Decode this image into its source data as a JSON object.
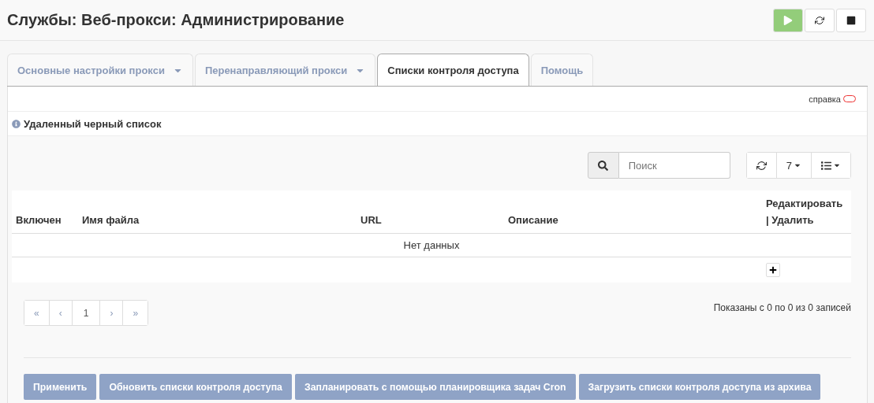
{
  "page_title": "Службы: Веб-прокси: Администрирование",
  "tabs": [
    {
      "label": "Основные настройки прокси",
      "selected": false,
      "has_menu": true
    },
    {
      "label": "Перенаправляющий прокси",
      "selected": false,
      "has_menu": true
    },
    {
      "label": "Списки контроля доступа",
      "selected": true,
      "has_menu": false
    },
    {
      "label": "Помощь",
      "selected": false,
      "has_menu": false
    }
  ],
  "help_toggle": {
    "label": "справка",
    "on": false
  },
  "section_title": "Удаленный черный список",
  "search": {
    "placeholder": "Поиск"
  },
  "page_size": "7",
  "table": {
    "columns": [
      "Включен",
      "Имя файла",
      "URL",
      "Описание",
      "Редактировать | Удалить"
    ],
    "empty_message": "Нет данных"
  },
  "pagination": [
    {
      "label": "«",
      "kind": "nav"
    },
    {
      "label": "‹",
      "kind": "nav"
    },
    {
      "label": "1",
      "kind": "page"
    },
    {
      "label": "›",
      "kind": "nav"
    },
    {
      "label": "»",
      "kind": "nav"
    }
  ],
  "records_info": "Показаны с 0 по 0 из 0 записей",
  "buttons": [
    "Применить",
    "Обновить списки контроля доступа",
    "Запланировать с помощью планировщика задач Cron",
    "Загрузить списки контроля доступа из архива"
  ]
}
